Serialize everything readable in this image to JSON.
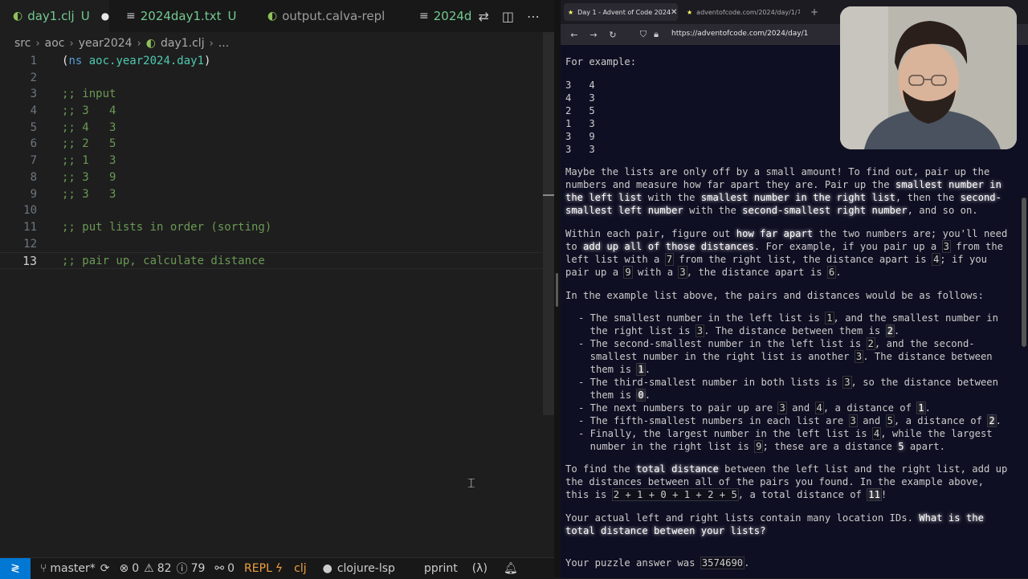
{
  "editor": {
    "tabs": [
      {
        "label": "day1.clj",
        "mod": "U"
      },
      {
        "label": "2024day1.txt",
        "mod": "U"
      },
      {
        "label": "output.calva-repl"
      },
      {
        "label": "2024d"
      }
    ],
    "breadcrumb": [
      "src",
      "aoc",
      "year2024",
      "day1.clj",
      "..."
    ],
    "line_numbers": [
      "1",
      "2",
      "3",
      "4",
      "5",
      "6",
      "7",
      "8",
      "9",
      "10",
      "11",
      "12",
      "13"
    ],
    "code": {
      "line1_open": "(",
      "line1_kw": "ns",
      "line1_ns": "aoc.year2024.day1",
      "line1_close": ")",
      "line3": ";; input",
      "line4": ";; 3   4",
      "line5": ";; 4   3",
      "line6": ";; 2   5",
      "line7": ";; 1   3",
      "line8": ";; 3   9",
      "line9": ";; 3   3",
      "line11": ";; put lists in order (sorting)",
      "line13": ";; pair up, calculate distance"
    }
  },
  "statusbar": {
    "branch": "master*",
    "errors": "0",
    "warnings": "82",
    "infos": "79",
    "ports": "0",
    "repl": "REPL",
    "lang": "clj",
    "lsp": "clojure-lsp",
    "pprint": "pprint",
    "lambda": "(λ)"
  },
  "browser": {
    "tabs": [
      {
        "label": "Day 1 - Advent of Code 2024"
      },
      {
        "label": "adventofcode.com/2024/day/1/"
      }
    ],
    "url": "https://adventofcode.com/2024/day/1",
    "content": {
      "for_example": "For example:",
      "example": [
        [
          "3",
          "4"
        ],
        [
          "4",
          "3"
        ],
        [
          "2",
          "5"
        ],
        [
          "1",
          "3"
        ],
        [
          "3",
          "9"
        ],
        [
          "3",
          "3"
        ]
      ],
      "p1": {
        "l1": "Maybe the lists are only off by a small amount! To find out, pair up the",
        "l2a": "numbers and measure how far apart they are. Pair up the ",
        "l2b": "smallest number in",
        "l3a": "the left list",
        "l3b": " with the ",
        "l3c": "smallest number in the right list",
        "l3d": ", then the ",
        "l3e": "second-",
        "l4a": "smallest left number",
        "l4b": " with the ",
        "l4c": "second-smallest right number",
        "l4d": ", and so on."
      },
      "p2": {
        "l1a": "Within each pair, figure out ",
        "l1b": "how far apart",
        "l1c": " the two numbers are; you'll need",
        "l2a": "to ",
        "l2b": "add up all of those distances",
        "l2c": ". For example, if you pair up a ",
        "l2d": "3",
        "l2e": " from the",
        "l3a": "left list with a ",
        "l3b": "7",
        "l3c": " from the right list, the distance apart is ",
        "l3d": "4",
        "l3e": "; if you",
        "l4a": "pair up a ",
        "l4b": "9",
        "l4c": " with a ",
        "l4d": "3",
        "l4e": ", the distance apart is ",
        "l4f": "6",
        "l4g": "."
      },
      "p3": "In the example list above, the pairs and distances would be as follows:",
      "list": {
        "b1l1a": "- The smallest number in the left list is ",
        "b1l1b": "1",
        "b1l1c": ", and the smallest number in",
        "b1l2a": "  the right list is ",
        "b1l2b": "3",
        "b1l2c": ". The distance between them is ",
        "b1l2d": "2",
        "b1l2e": ".",
        "b2l1a": "- The second-smallest number in the left list is ",
        "b2l1b": "2",
        "b2l1c": ", and the second-",
        "b2l2a": "  smallest number in the right list is another ",
        "b2l2b": "3",
        "b2l2c": ". The distance between",
        "b2l3a": "  them is ",
        "b2l3b": "1",
        "b2l3c": ".",
        "b3l1a": "- The third-smallest number in both lists is ",
        "b3l1b": "3",
        "b3l1c": ", so the distance between",
        "b3l2a": "  them is ",
        "b3l2b": "0",
        "b3l2c": ".",
        "b4a": "- The next numbers to pair up are ",
        "b4b": "3",
        "b4c": " and ",
        "b4d": "4",
        "b4e": ", a distance of ",
        "b4f": "1",
        "b4g": ".",
        "b5a": "- The fifth-smallest numbers in each list are ",
        "b5b": "3",
        "b5c": " and ",
        "b5d": "5",
        "b5e": ", a distance of ",
        "b5f": "2",
        "b5g": ".",
        "b6l1a": "- Finally, the largest number in the left list is ",
        "b6l1b": "4",
        "b6l1c": ", while the largest",
        "b6l2a": "  number in the right list is ",
        "b6l2b": "9",
        "b6l2c": "; these are a distance ",
        "b6l2d": "5",
        "b6l2e": " apart."
      },
      "p4": {
        "l1a": "To find the ",
        "l1b": "total distance",
        "l1c": " between the left list and the right list, add up",
        "l2": "the distances between all of the pairs you found. In the example above,",
        "l3a": "this is ",
        "l3b": "2 + 1 + 0 + 1 + 2 + 5",
        "l3c": ", a total distance of ",
        "l3d": "11",
        "l3e": "!"
      },
      "p5": {
        "l1a": "Your actual left and right lists contain many location IDs. ",
        "l1b": "What is the",
        "l2": "total distance between your lists?"
      },
      "answer_a": "Your puzzle answer was ",
      "answer_b": "3574690",
      "answer_c": "."
    }
  },
  "colors": {
    "comment": "#6a9955",
    "keyword": "#569cd6",
    "namespace": "#4ec9b0",
    "aoc_bg": "#0f0f23",
    "remote_blue": "#0078d4"
  }
}
